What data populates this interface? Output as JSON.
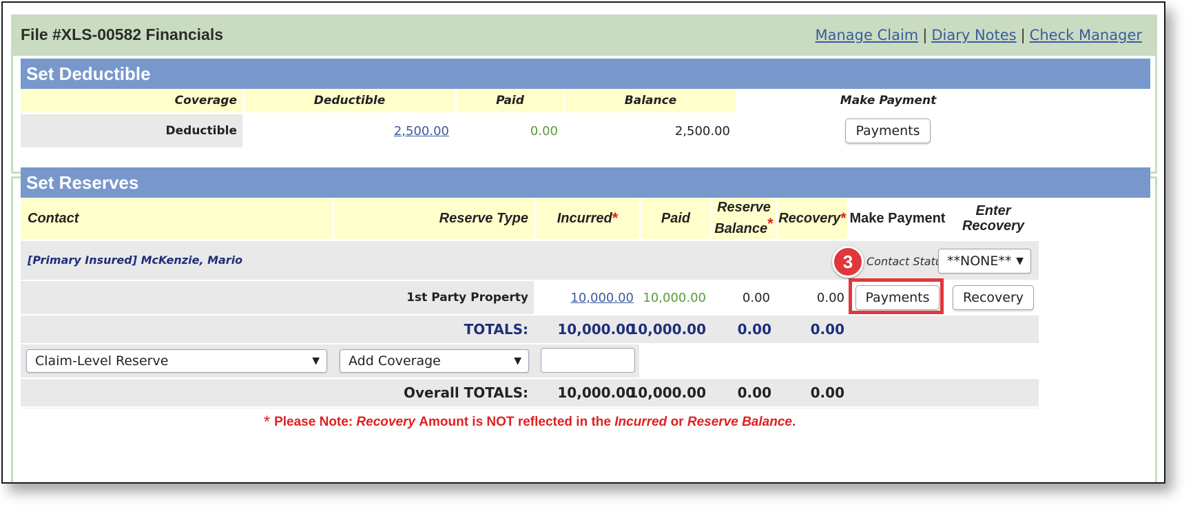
{
  "header": {
    "title": "File #XLS-00582 Financials",
    "links": [
      "Manage Claim",
      "Diary Notes",
      "Check Manager"
    ],
    "separator": "|"
  },
  "deductible": {
    "section_title": "Set Deductible",
    "columns": [
      "Coverage",
      "Deductible",
      "Paid",
      "Balance",
      "Make Payment"
    ],
    "row": {
      "coverage": "Deductible",
      "deductible": "2,500.00",
      "paid": "0.00",
      "balance": "2,500.00",
      "button": "Payments"
    }
  },
  "reserves": {
    "section_title": "Set Reserves",
    "columns": {
      "contact": "Contact",
      "reserve_type": "Reserve Type",
      "incurred": "Incurred",
      "paid": "Paid",
      "reserve_balance_1": "Reserve",
      "reserve_balance_2": "Balance",
      "recovery": "Recovery",
      "make_payment": "Make Payment",
      "enter_recovery_1": "Enter",
      "enter_recovery_2": "Recovery"
    },
    "required_mark": "*",
    "contact": {
      "name": "[Primary Insured] McKenzie, Mario",
      "status_label": "Contact Status",
      "status_value": "**NONE**"
    },
    "row": {
      "reserve_type": "1st Party Property",
      "incurred": "10,000.00",
      "paid": "10,000.00",
      "reserve_balance": "0.00",
      "recovery": "0.00",
      "payments_button": "Payments",
      "recovery_button": "Recovery"
    },
    "totals": {
      "label": "TOTALS:",
      "incurred": "10,000.00",
      "paid": "10,000.00",
      "reserve_balance": "0.00",
      "recovery": "0.00"
    },
    "add_row": {
      "claim_level_select": "Claim-Level Reserve",
      "add_coverage_select": "Add Coverage",
      "amount_input": ""
    },
    "overall_totals": {
      "label": "Overall TOTALS:",
      "incurred": "10,000.00",
      "paid": "10,000.00",
      "reserve_balance": "0.00",
      "recovery": "0.00"
    }
  },
  "note": {
    "star": "*",
    "prefix": "Please Note:",
    "recovery": "Recovery",
    "middle": "Amount is NOT reflected in the",
    "incurred": "Incurred",
    "or": "or",
    "reserve_balance": "Reserve Balance",
    "end": "."
  },
  "annotation": {
    "step": "3",
    "highlight_color": "#e0383a"
  },
  "colors": {
    "header_bg": "#c9dcc1",
    "section_bar": "#7898cc",
    "column_header_bg": "#ffffcc",
    "link": "#3c5aa0",
    "paid_green": "#5a9a3a",
    "totals_navy": "#1f2f7a",
    "note_red": "#e02020"
  },
  "icons": {
    "dropdown": "caret-down-icon"
  }
}
